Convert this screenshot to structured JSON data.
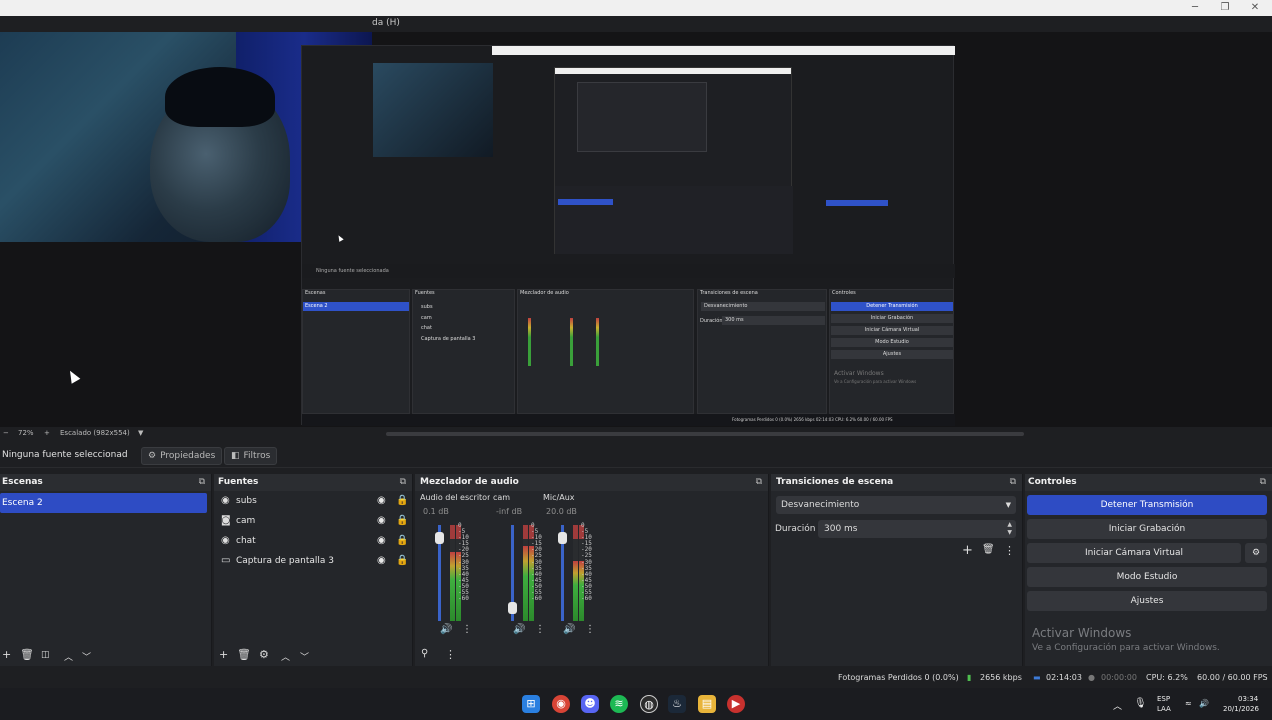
{
  "window": {
    "menu_fragment": "da (H)",
    "minimize": "─",
    "maximize": "❐",
    "close": "✕"
  },
  "preview": {
    "zoom_minus": "−",
    "zoom": "72%",
    "zoom_plus": "+",
    "scale_mode": "Escalado (982x554)",
    "scale_chevron": "▼"
  },
  "context": {
    "no_source": "Ninguna fuente seleccionad",
    "properties": "Propiedades",
    "filters": "Filtros"
  },
  "scenes": {
    "title": "Escenas",
    "items": [
      "Escena 2"
    ]
  },
  "sources": {
    "title": "Fuentes",
    "items": [
      {
        "name": "subs",
        "icon": "globe-icon"
      },
      {
        "name": "cam",
        "icon": "camera-icon"
      },
      {
        "name": "chat",
        "icon": "globe-icon"
      },
      {
        "name": "Captura de pantalla 3",
        "icon": "monitor-icon"
      }
    ]
  },
  "mixer": {
    "title": "Mezclador de audio",
    "channels": [
      {
        "name": "Audio del escritorio",
        "db": "0.1 dB",
        "fader_level": 0.92,
        "meter_level": 0.72
      },
      {
        "name": "cam",
        "db": "-inf dB",
        "fader_level": 0.08,
        "meter_level": 0.78
      },
      {
        "name": "Mic/Aux",
        "db": "20.0 dB",
        "fader_level": 0.92,
        "meter_level": 0.62
      }
    ],
    "scale": [
      "0",
      "-5",
      "-10",
      "-15",
      "-20",
      "-25",
      "-30",
      "-35",
      "-40",
      "-45",
      "-50",
      "-55",
      "-60"
    ]
  },
  "transitions": {
    "title": "Transiciones de escena",
    "selected": "Desvanecimiento",
    "duration_label": "Duración",
    "duration_value": "300 ms"
  },
  "controls": {
    "title": "Controles",
    "stop_stream": "Detener Transmisión",
    "start_recording": "Iniciar Grabación",
    "start_virtual_cam": "Iniciar Cámara Virtual",
    "studio_mode": "Modo Estudio",
    "settings": "Ajustes",
    "activate_title": "Activar Windows",
    "activate_sub": "Ve a Configuración para activar Windows."
  },
  "status": {
    "dropped_frames": "Fotogramas Perdidos 0 (0.0%)",
    "bitrate": "2656 kbps",
    "stream_time": "02:14:03",
    "rec_time": "00:00:00",
    "cpu": "CPU: 6.2%",
    "fps": "60.00 / 60.00 FPS"
  },
  "taskbar": {
    "lang_top": "ESP",
    "lang_bottom": "LAA",
    "time": "03:34",
    "date": "20/1/2026"
  },
  "nested": {
    "no_source": "Ninguna fuente seleccionada",
    "scenes": "Escenas",
    "scene": "Escena 2",
    "sources": "Fuentes",
    "src": [
      "subs",
      "cam",
      "chat",
      "Captura de pantalla 3"
    ],
    "mixer": "Mezclador de audio",
    "transitions": "Transiciones de escena",
    "fade": "Desvanecimiento",
    "duration_label": "Duración",
    "duration_value": "300 ms",
    "controls": "Controles",
    "stop": "Detener Transmisión",
    "rec": "Iniciar Grabación",
    "vcam": "Iniciar Cámara Virtual",
    "studio": "Modo Estudio",
    "settings": "Ajustes",
    "activate": "Activar Windows",
    "activate_sub": "Ve a Configuración para activar Windows",
    "status": "Fotogramas Perdidos 0 (0.0%)   2656 kbps   02:14:03   CPU: 6.2%   60.00 / 60.00 FPS"
  },
  "colors": {
    "accent": "#2e4cc4",
    "panel": "#24262a",
    "bg": "#1e1f22"
  }
}
